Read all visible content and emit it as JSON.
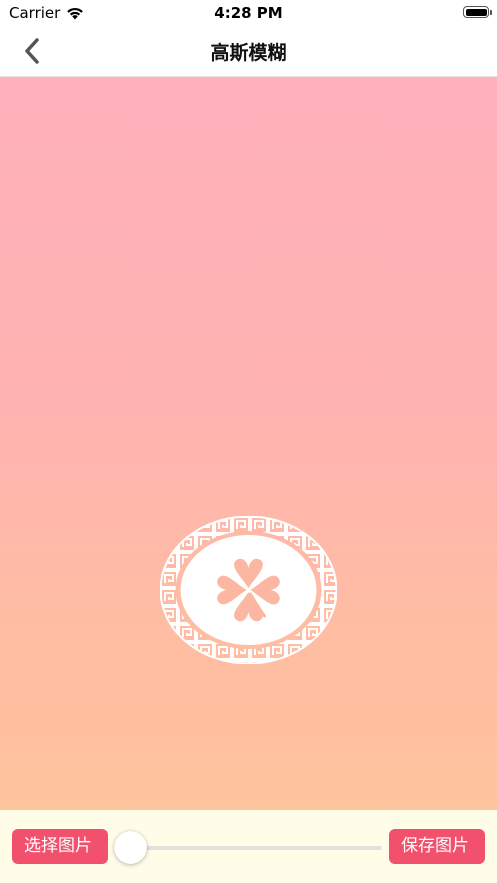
{
  "status_bar": {
    "carrier": "Carrier",
    "time": "4:28 PM"
  },
  "nav": {
    "title": "高斯模糊",
    "back_icon": "chevron-left-icon"
  },
  "image": {
    "emblem_icon": "four-leaf-clover-icon",
    "gradient_top": "#ffb0bb",
    "gradient_bottom": "#ffc39e"
  },
  "toolbar": {
    "select_label": "选择图片",
    "save_label": "保存图片",
    "slider_value": 0,
    "accent_color": "#f2516e"
  }
}
